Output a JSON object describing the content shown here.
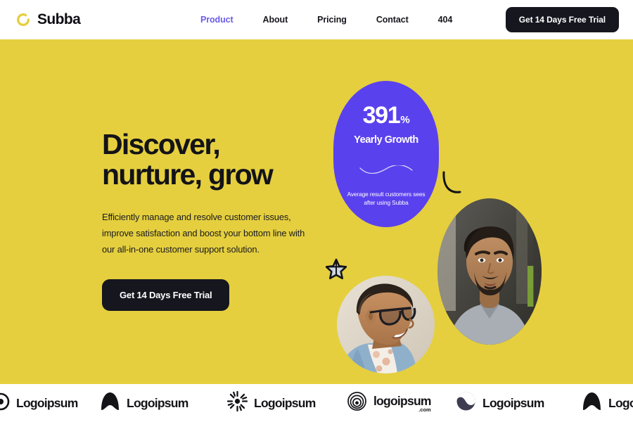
{
  "brand": {
    "name": "Subba",
    "mark_icon": "ring-gap-icon",
    "mark_color": "#e5cf3e"
  },
  "nav": {
    "items": [
      {
        "label": "Product",
        "active": true
      },
      {
        "label": "About",
        "active": false
      },
      {
        "label": "Pricing",
        "active": false
      },
      {
        "label": "Contact",
        "active": false
      },
      {
        "label": "404",
        "active": false
      }
    ],
    "active_color": "#6b5ce7",
    "cta_label": "Get 14 Days Free Trial"
  },
  "hero": {
    "title_line1": "Discover,",
    "title_line2": "nurture, grow",
    "subtitle": "Efficiently manage and resolve customer issues, improve satisfaction and boost your bottom line with our all-in-one customer support solution.",
    "cta_label": "Get 14 Days Free Trial",
    "background_color": "#e5cf3e"
  },
  "stat_card": {
    "value": "391",
    "unit": "%",
    "label": "Yearly Growth",
    "note": "Average result customers sees after using Subba",
    "background_color": "#5a41ee",
    "divider_icon": "wave-line-icon"
  },
  "decor": {
    "arc_icon": "arc-curve-icon",
    "star_icon": "star-outline-icon",
    "color": "#131318"
  },
  "photos": [
    {
      "name": "portrait-bearded-man",
      "alt": "Smiling bearded man in grey t-shirt"
    },
    {
      "name": "portrait-man-glasses",
      "alt": "Smiling man with glasses in denim jacket"
    }
  ],
  "logo_strip": {
    "items": [
      {
        "mark_icon": "circle-dot-icon",
        "word": "Logoipsum",
        "tld": ""
      },
      {
        "mark_icon": "arch-dome-icon",
        "word": "Logoipsum",
        "tld": ""
      },
      {
        "mark_icon": "sunburst-icon",
        "word": "Logoipsum",
        "tld": ""
      },
      {
        "mark_icon": "spiral-icon",
        "word": "logoipsum",
        "tld": ".com"
      },
      {
        "mark_icon": "yin-yang-icon",
        "word": "Logoipsum",
        "tld": ""
      },
      {
        "mark_icon": "arch-dome-icon",
        "word": "Logoipsum",
        "tld": ""
      }
    ]
  }
}
